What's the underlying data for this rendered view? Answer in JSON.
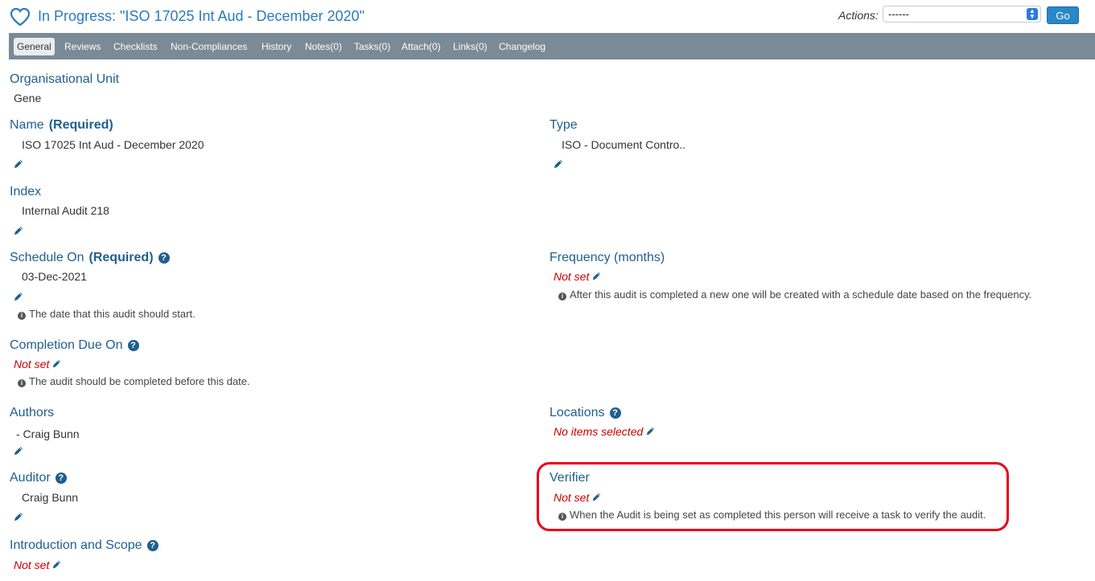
{
  "header": {
    "title": "In Progress: \"ISO 17025 Int Aud - December 2020\"",
    "actions_label": "Actions:",
    "actions_selected": "------",
    "go_label": "Go"
  },
  "tabs": [
    {
      "label": "General",
      "active": true
    },
    {
      "label": "Reviews"
    },
    {
      "label": "Checklists"
    },
    {
      "label": "Non-Compliances"
    },
    {
      "label": "History"
    },
    {
      "label": "Notes(0)"
    },
    {
      "label": "Tasks(0)"
    },
    {
      "label": "Attach(0)"
    },
    {
      "label": "Links(0)"
    },
    {
      "label": "Changelog"
    }
  ],
  "fields": {
    "org_unit": {
      "label": "Organisational Unit",
      "value": "Gene"
    },
    "name": {
      "label": "Name",
      "required": "(Required)",
      "value": "ISO 17025 Int Aud - December 2020"
    },
    "type": {
      "label": "Type",
      "value": "ISO - Document Contro.."
    },
    "index": {
      "label": "Index",
      "value": "Internal Audit 218"
    },
    "schedule_on": {
      "label": "Schedule On",
      "required": "(Required)",
      "value": "03-Dec-2021",
      "help": "The date that this audit should start."
    },
    "frequency": {
      "label": "Frequency (months)",
      "value": "Not set",
      "help": "After this audit is completed a new one will be created with a schedule date based on the frequency."
    },
    "completion_due": {
      "label": "Completion Due On",
      "value": "Not set",
      "help": "The audit should be completed before this date."
    },
    "authors": {
      "label": "Authors",
      "value": "- Craig Bunn"
    },
    "locations": {
      "label": "Locations",
      "value": "No items selected"
    },
    "auditor": {
      "label": "Auditor",
      "value": "Craig Bunn"
    },
    "verifier": {
      "label": "Verifier",
      "value": "Not set",
      "help": "When the Audit is being set as completed this person will receive a task to verify the audit."
    },
    "intro_scope": {
      "label": "Introduction and Scope",
      "value": "Not set"
    }
  },
  "colors": {
    "accent": "#2a7ac0",
    "label": "#1f5f8d",
    "not_set": "#cc0000",
    "tabbar": "#7b8a97",
    "highlight": "#e8001c"
  }
}
